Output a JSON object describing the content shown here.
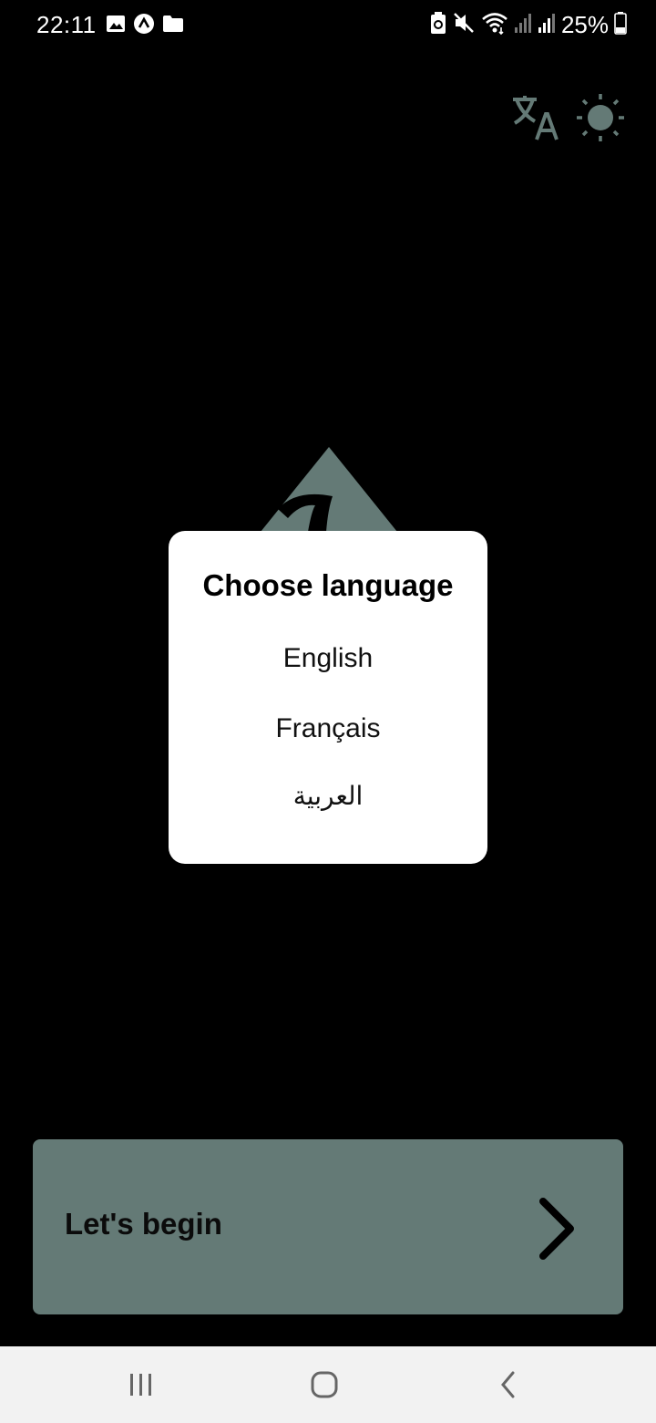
{
  "status_bar": {
    "time": "22:11",
    "battery": "25%",
    "left_icons": [
      "gallery-icon",
      "app-notification-icon",
      "folder-icon"
    ],
    "right_icons": [
      "battery-saver-icon",
      "mute-icon",
      "wifi-icon",
      "signal-icon",
      "signal-icon",
      "battery-icon"
    ]
  },
  "top_actions": {
    "translate_icon": "translate-icon",
    "theme_icon": "sun-icon"
  },
  "dialog": {
    "title": "Choose language",
    "options": [
      "English",
      "Français",
      "العربية"
    ]
  },
  "begin_button": {
    "label": "Let's begin",
    "icon": "chevron-right-icon"
  },
  "nav_bar": {
    "icons": [
      "recent-apps-icon",
      "home-icon",
      "back-icon"
    ]
  },
  "colors": {
    "background": "#000000",
    "accent": "#647a76",
    "dialog": "#ffffff",
    "nav_bar": "#f2f2f2"
  }
}
